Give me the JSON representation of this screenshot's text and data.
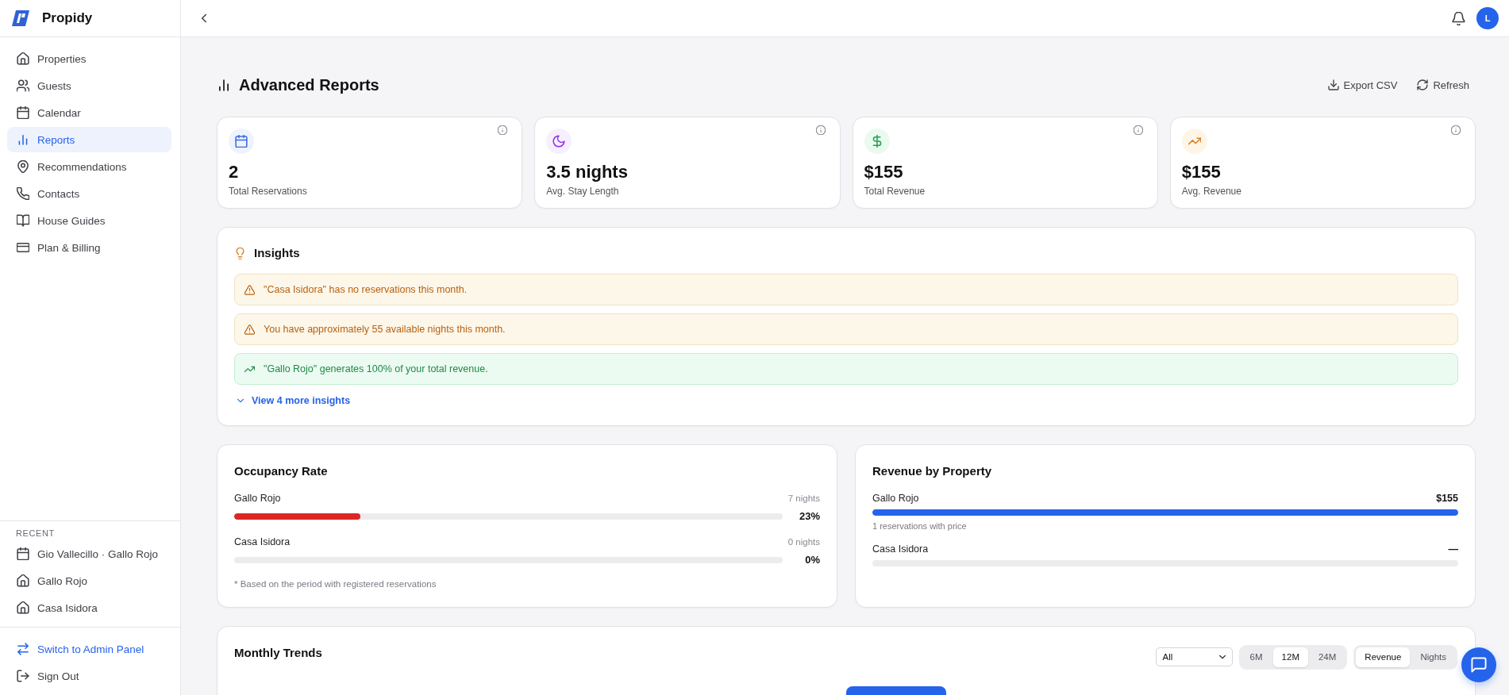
{
  "sidebar": {
    "brand": "Propidy",
    "nav": [
      {
        "label": "Properties",
        "kind": "home",
        "selected": false
      },
      {
        "label": "Guests",
        "kind": "people",
        "selected": false
      },
      {
        "label": "Calendar",
        "kind": "calendar",
        "selected": false
      },
      {
        "label": "Reports",
        "kind": "chart",
        "selected": true
      },
      {
        "label": "Recommendations",
        "kind": "pin",
        "selected": false
      },
      {
        "label": "Contacts",
        "kind": "phone",
        "selected": false
      },
      {
        "label": "House Guides",
        "kind": "book",
        "selected": false
      },
      {
        "label": "Plan & Billing",
        "kind": "card",
        "selected": false
      }
    ],
    "recent": {
      "heading": "RECENT",
      "items": [
        {
          "label": "Gio Vallecillo · Gallo Rojo",
          "kind": "calendar"
        },
        {
          "label": "Gallo Rojo",
          "kind": "home"
        },
        {
          "label": "Casa Isidora",
          "kind": "home"
        }
      ]
    },
    "footer": [
      {
        "label": "Switch to Admin Panel",
        "kind": "swap"
      },
      {
        "label": "Sign Out",
        "kind": "exit"
      }
    ]
  },
  "topbar": {
    "avatar": "L"
  },
  "page": {
    "title": "Advanced Reports",
    "actions": [
      {
        "label": "Export CSV",
        "kind": "download"
      },
      {
        "label": "Refresh",
        "kind": "refresh"
      }
    ]
  },
  "kpis": [
    {
      "kind": "calendar",
      "value": "2",
      "label": "Total Reservations"
    },
    {
      "kind": "moon",
      "value": "3.5 nights",
      "label": "Avg. Stay Length"
    },
    {
      "kind": "dollar",
      "value": "$155",
      "label": "Total Revenue"
    },
    {
      "kind": "trend",
      "value": "$155",
      "label": "Avg. Revenue"
    }
  ],
  "insights": {
    "title": "Insights",
    "items": [
      {
        "kind": "warning",
        "text": "\"Casa Isidora\" has no reservations this month."
      },
      {
        "kind": "warning",
        "text": "You have approximately 55 available nights this month."
      },
      {
        "kind": "success",
        "text": "\"Gallo Rojo\" generates 100% of your total revenue."
      }
    ],
    "more": "View 4 more insights"
  },
  "occupancy": {
    "title": "Occupancy Rate",
    "rows": [
      {
        "name": "Gallo Rojo",
        "nights": "7 nights",
        "level": 0.23,
        "percent": "23%"
      },
      {
        "name": "Casa Isidora",
        "nights": "0 nights",
        "percent": "0%"
      }
    ],
    "note": "* Based on the period with registered reservations"
  },
  "revenue": {
    "title": "Revenue by Property",
    "rows": [
      {
        "name": "Gallo Rojo",
        "amount": "$155",
        "level": 1,
        "detail": "1 reservations with price"
      },
      {
        "name": "Casa Isidora",
        "amount": "—"
      }
    ]
  },
  "trends": {
    "title": "Monthly Trends",
    "filter": {
      "value": "All"
    },
    "ranges": [
      {
        "label": "6M",
        "selected": false
      },
      {
        "label": "12M",
        "selected": true
      },
      {
        "label": "24M",
        "selected": false
      }
    ],
    "metrics": [
      {
        "label": "Revenue",
        "selected": true
      },
      {
        "label": "Nights",
        "selected": false
      }
    ]
  }
}
